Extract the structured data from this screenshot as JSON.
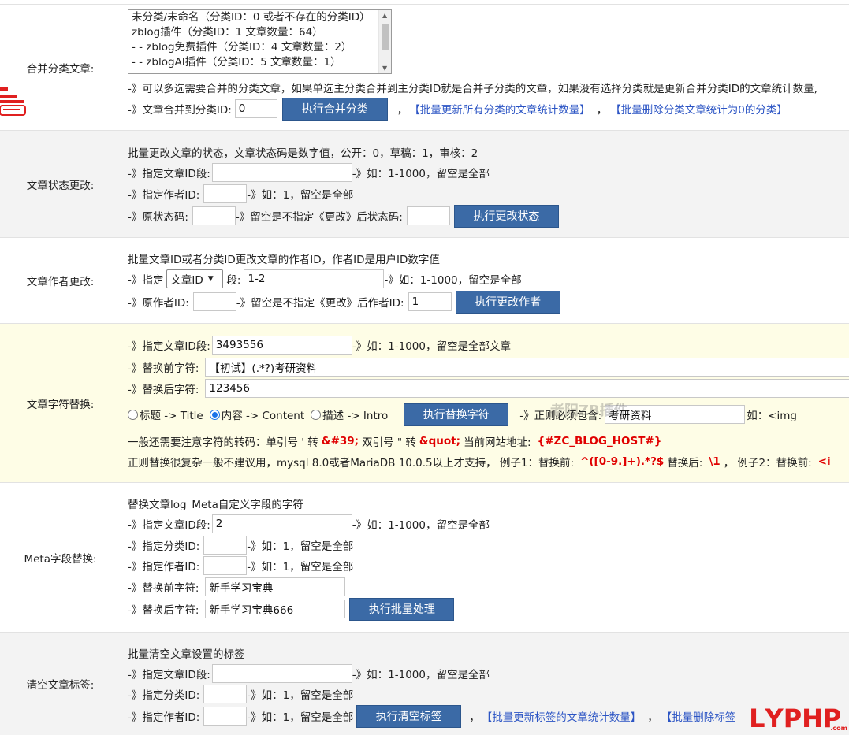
{
  "sections": {
    "merge": {
      "label": "合并分类文章:",
      "category_options": [
        "未分类/未命名（分类ID：0 或者不存在的分类ID）",
        "zblog插件（分类ID：1 文章数量：64）",
        "- - zblog免费插件（分类ID：4 文章数量：2）",
        "- - zblogAI插件（分类ID：5 文章数量：1）"
      ],
      "hint": "-》可以多选需要合并的分类文章，如果单选主分类合并到主分类ID就是合并子分类的文章，如果没有选择分类就是更新合并分类ID的文章统计数量,",
      "target_label": "-》文章合并到分类ID:",
      "target_value": "0",
      "button": "执行合并分类",
      "sep1": "，",
      "link1": "【批量更新所有分类的文章统计数量】",
      "sep2": "，",
      "link2": "【批量删除分类文章统计为0的分类】"
    },
    "status": {
      "label": "文章状态更改:",
      "desc": "批量更改文章的状态，文章状态码是数字值，公开：0，草稿：1，审核：2",
      "l1_prefix": "-》指定文章ID段:",
      "l1_suffix": "-》如：1-1000，留空是全部",
      "l2_prefix": "-》指定作者ID:",
      "l2_suffix": "-》如：1，留空是全部",
      "l3_prefix": "-》原状态码:",
      "l3_mid": "-》留空是不指定《更改》后状态码:",
      "button": "执行更改状态"
    },
    "author": {
      "label": "文章作者更改:",
      "desc": "批量文章ID或者分类ID更改文章的作者ID，作者ID是用户ID数字值",
      "l1_prefix": "-》指定",
      "select_value": "文章ID",
      "l1_mid": "段:",
      "range_value": "1-2",
      "l1_suffix": "-》如：1-1000，留空是全部",
      "l2_prefix": "-》原作者ID:",
      "l2_mid": "-》留空是不指定《更改》后作者ID:",
      "new_author_value": "1",
      "button": "执行更改作者"
    },
    "replace": {
      "label": "文章字符替换:",
      "l1_prefix": "-》指定文章ID段:",
      "l1_value": "3493556",
      "l1_suffix": "-》如：1-1000，留空是全部文章",
      "l2_prefix": "-》替换前字符:",
      "l2_value": "【初试】(.*?)考研资料",
      "l3_prefix": "-》替换后字符:",
      "l3_value": "123456",
      "radio_title": "标题 -> Title",
      "radio_content": "内容 -> Content",
      "radio_intro": "描述 -> Intro",
      "button": "执行替换字符",
      "regex_prefix": "-》正则必须包含:",
      "regex_value": "考研资料",
      "regex_suffix": "如：<img",
      "note1_prefix": "一般还需要注意字符的转码：单引号 ' 转",
      "note1_code1": "&#39;",
      "note1_mid": "双引号 \" 转",
      "note1_code2": "&quot;",
      "note1_mid2": "当前网站地址:",
      "note1_host": "{#ZC_BLOG_HOST#}",
      "note2_prefix": "正则替换很复杂一般不建议用，mysql 8.0或者MariaDB 10.0.5以上才支持，  例子1：替换前:",
      "note2_code1": "^([0-9.]+).*?$",
      "note2_mid": "替换后:",
      "note2_code2": "\\1",
      "note2_mid2": "，  例子2：替换前:",
      "note2_code3": "<i"
    },
    "meta": {
      "label": "Meta字段替换:",
      "desc": "替换文章log_Meta自定义字段的字符",
      "l1_prefix": "-》指定文章ID段:",
      "l1_value": "2",
      "l1_suffix": "-》如：1-1000，留空是全部",
      "l2_prefix": "-》指定分类ID:",
      "l2_suffix": "-》如：1，留空是全部",
      "l3_prefix": "-》指定作者ID:",
      "l3_suffix": "-》如：1，留空是全部",
      "l4_prefix": "-》替换前字符:",
      "l4_value": "新手学习宝典",
      "l5_prefix": "-》替换后字符:",
      "l5_value": "新手学习宝典666",
      "button": "执行批量处理"
    },
    "tags": {
      "label": "清空文章标签:",
      "desc": "批量清空文章设置的标签",
      "l1_prefix": "-》指定文章ID段:",
      "l1_suffix": "-》如：1-1000，留空是全部",
      "l2_prefix": "-》指定分类ID:",
      "l2_suffix": "-》如：1，留空是全部",
      "l3_prefix": "-》指定作者ID:",
      "l3_suffix": "-》如：1，留空是全部",
      "button": "执行清空标签",
      "sep1": "，",
      "link1": "【批量更新标签的文章统计数量】",
      "sep2": "，",
      "link2": "【批量删除标签"
    }
  },
  "watermark": "老阳ZB插件",
  "logo": {
    "letters": [
      "L",
      "Y",
      "P",
      "H",
      "P"
    ],
    "small": ".com"
  },
  "colors": {
    "button_bg": "#3b6aa6",
    "link": "#2b54c4",
    "code_red": "#e00000",
    "yellow_row": "#fefde6",
    "gray_row": "#f3f3f3"
  }
}
